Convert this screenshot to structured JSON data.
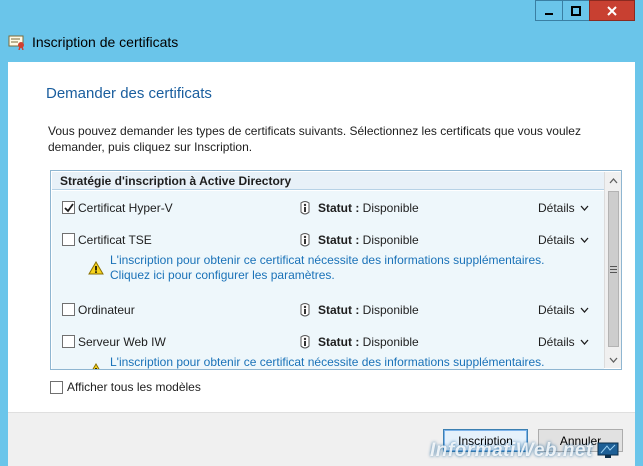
{
  "window": {
    "title": "Inscription de certificats",
    "controls": [
      "minimize",
      "maximize",
      "close"
    ]
  },
  "page": {
    "heading": "Demander des certificats",
    "description": "Vous pouvez demander les types de certificats suivants. Sélectionnez les certificats que vous voulez demander, puis cliquez sur Inscription."
  },
  "list": {
    "header": "Stratégie d'inscription à Active Directory",
    "items": [
      {
        "label": "Certificat Hyper-V",
        "checked": true,
        "status_label": "Statut :",
        "status_value": "Disponible",
        "details": "Détails"
      },
      {
        "label": "Certificat TSE",
        "checked": false,
        "status_label": "Statut :",
        "status_value": "Disponible",
        "details": "Détails",
        "warning": [
          "L'inscription pour obtenir ce certificat nécessite des informations supplémentaires.",
          "Cliquez ici pour configurer les paramètres."
        ]
      },
      {
        "label": "Ordinateur",
        "checked": false,
        "status_label": "Statut :",
        "status_value": "Disponible",
        "details": "Détails"
      },
      {
        "label": "Serveur Web IW",
        "checked": false,
        "status_label": "Statut :",
        "status_value": "Disponible",
        "details": "Détails",
        "warning": [
          "L'inscription pour obtenir ce certificat nécessite des informations supplémentaires."
        ]
      }
    ]
  },
  "show_all": {
    "label": "Afficher tous les modèles",
    "checked": false
  },
  "buttons": {
    "inscription": "Inscription",
    "annuler": "Annuler"
  },
  "watermark": "InformatiWeb.net",
  "colors": {
    "titlebar": "#6ac5ea",
    "heading": "#1a5e9e",
    "link": "#1a72b8",
    "close": "#c84031"
  },
  "icons": [
    "certificate-icon",
    "info-icon",
    "warning-icon",
    "chevron-down-icon",
    "checkmark-icon"
  ]
}
